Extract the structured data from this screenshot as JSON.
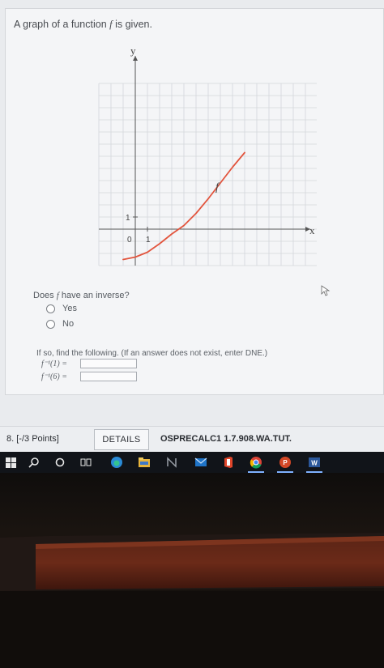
{
  "question": {
    "title_prefix": "A graph of a function ",
    "title_var": "f",
    "title_suffix": " is given.",
    "prompt_prefix": "Does ",
    "prompt_var": "f",
    "prompt_suffix": " have an inverse?",
    "options": [
      {
        "label": "Yes",
        "selected": false
      },
      {
        "label": "No",
        "selected": false
      }
    ],
    "instruction": "If so, find the following. (If an answer does not exist, enter DNE.)",
    "answers": [
      {
        "label": "f⁻¹(1) =",
        "value": ""
      },
      {
        "label": "f⁻¹(6) =",
        "value": ""
      }
    ]
  },
  "graph": {
    "y_axis_label": "y",
    "x_axis_label": "x",
    "tick_one_x": "1",
    "tick_one_y": "1",
    "origin_label": "0",
    "curve_label": "f",
    "curve_color": "#e2553e"
  },
  "chart_data": {
    "type": "line",
    "xlabel": "x",
    "ylabel": "y",
    "xlim": [
      -2,
      10
    ],
    "ylim": [
      -3,
      8
    ],
    "series": [
      {
        "name": "f",
        "x": [
          -1,
          0,
          1,
          2,
          3,
          4,
          5,
          6,
          7,
          8,
          9
        ],
        "y": [
          -2.5,
          -2.3,
          -1.9,
          -1.2,
          -0.4,
          0.3,
          1.3,
          2.5,
          3.8,
          5.1,
          6.3
        ]
      }
    ],
    "grid": true
  },
  "next_question": {
    "number_label": "8.",
    "points_label": "[-/3 Points]",
    "details_label": "DETAILS",
    "code": "OSPRECALC1 1.7.908.WA.TUT."
  },
  "taskbar": {
    "icons": [
      "windows-start-icon",
      "search-icon",
      "cortana-icon",
      "task-view-icon",
      "edge-icon",
      "file-explorer-icon",
      "onenote-icon",
      "mail-icon",
      "office-icon",
      "chrome-icon",
      "powerpoint-icon",
      "word-icon"
    ]
  }
}
